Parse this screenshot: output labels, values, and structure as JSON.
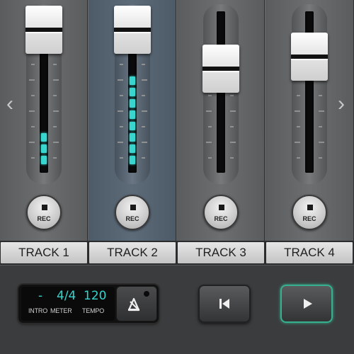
{
  "nav": {
    "prev_arrow": "‹",
    "next_arrow": "›"
  },
  "tracks": [
    {
      "label": "TRACK 1",
      "rec_label": "REC",
      "selected": false,
      "fader_level": 1.0,
      "meter_level": 0.33
    },
    {
      "label": "TRACK 2",
      "rec_label": "REC",
      "selected": true,
      "fader_level": 1.0,
      "meter_level": 1.0
    },
    {
      "label": "TRACK 3",
      "rec_label": "REC",
      "selected": false,
      "fader_level": 0.63,
      "meter_level": 0.0
    },
    {
      "label": "TRACK 4",
      "rec_label": "REC",
      "selected": false,
      "fader_level": 0.74,
      "meter_level": 0.0
    }
  ],
  "transport": {
    "intro_value": "-",
    "meter_value": "4/4",
    "tempo_value": "120",
    "intro_label": "INTRO",
    "meter_label": "METER",
    "tempo_label": "TEMPO",
    "metronome_icon": "metronome-icon",
    "rewind_icon": "skip-to-start-icon",
    "play_icon": "play-icon"
  },
  "colors": {
    "meter": "#39d6cf",
    "selected_strip": "#5d6b79",
    "play_accent": "#37b08f"
  }
}
